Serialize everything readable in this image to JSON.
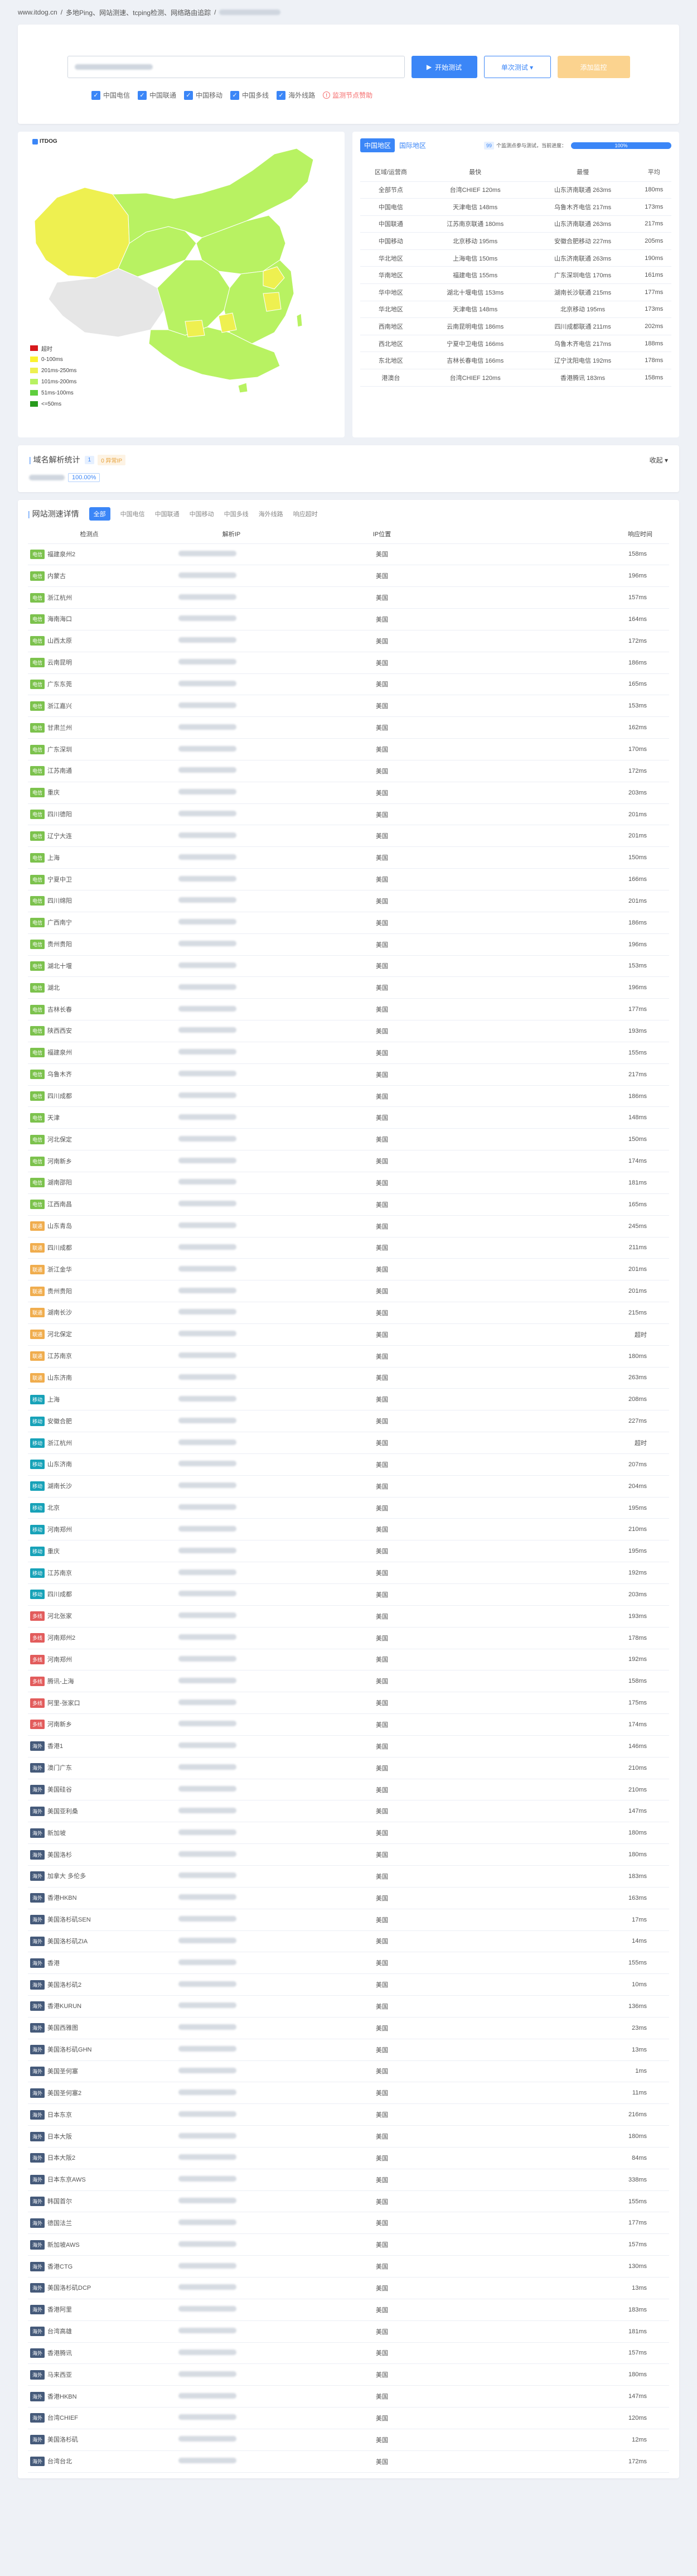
{
  "breadcrumb": [
    "www.itdog.cn",
    "/",
    "多地Ping、网站测速、tcping检测、网络路由追踪",
    "/"
  ],
  "test": {
    "start_label": "开始测试",
    "single_label": "单次测试 ▾",
    "subscribe_label": "添加监控",
    "checks": [
      "中国电信",
      "中国联通",
      "中国移动",
      "中国多线",
      "海外线路"
    ],
    "alert": "监测节点赞助"
  },
  "map": {
    "brand": "ITDOG",
    "legend": [
      {
        "label": "超时",
        "color": "#d7191c"
      },
      {
        "label": "0-100ms",
        "color": "#fcf230"
      },
      {
        "label": "201ms-250ms",
        "color": "#eef050"
      },
      {
        "label": "101ms-200ms",
        "color": "#b8f262"
      },
      {
        "label": "51ms-100ms",
        "color": "#5fce3e"
      },
      {
        "label": "<=50ms",
        "color": "#279a1c"
      }
    ]
  },
  "stats": {
    "tab_cn": "中国地区",
    "tab_intl": "国际地区",
    "nodes": "99",
    "nodes_text": "个监测点参与测试，当前进度：",
    "progress_label": "100%",
    "progress": 1.0,
    "headers": [
      "区域/运营商",
      "最快",
      "最慢",
      "平均"
    ],
    "rows": [
      [
        "全部节点",
        "台湾CHIEF 120ms",
        "山东济南联通 263ms",
        "180ms"
      ],
      [
        "中国电信",
        "天津电信 148ms",
        "乌鲁木齐电信 217ms",
        "173ms"
      ],
      [
        "中国联通",
        "江苏南京联通 180ms",
        "山东济南联通 263ms",
        "217ms"
      ],
      [
        "中国移动",
        "北京移动 195ms",
        "安徽合肥移动 227ms",
        "205ms"
      ],
      [
        "华北地区",
        "上海电信 150ms",
        "山东济南联通 263ms",
        "190ms"
      ],
      [
        "华南地区",
        "福建电信 155ms",
        "广东深圳电信 170ms",
        "161ms"
      ],
      [
        "华中地区",
        "湖北十堰电信 153ms",
        "湖南长沙联通 215ms",
        "177ms"
      ],
      [
        "华北地区",
        "天津电信 148ms",
        "北京移动 195ms",
        "173ms"
      ],
      [
        "西南地区",
        "云南昆明电信 186ms",
        "四川成都联通 211ms",
        "202ms"
      ],
      [
        "西北地区",
        "宁夏中卫电信 166ms",
        "乌鲁木齐电信 217ms",
        "188ms"
      ],
      [
        "东北地区",
        "吉林长春电信 166ms",
        "辽宁沈阳电信 192ms",
        "178ms"
      ],
      [
        "港澳台",
        "台湾CHIEF 120ms",
        "香港腾讯 183ms",
        "158ms"
      ]
    ]
  },
  "dns": {
    "title": "域名解析统计",
    "count": "1",
    "pending": "0 异常IP",
    "fold": "收起 ▾",
    "pct": "100.00%"
  },
  "detail": {
    "title": "网站测速详情",
    "tabs": [
      "全部",
      "中国电信",
      "中国联通",
      "中国移动",
      "中国多线",
      "海外线路",
      "响应超时"
    ],
    "headers": [
      "检测点",
      "解析IP",
      "IP位置",
      "响应时间"
    ],
    "isp_colors": {
      "电信": "#7cc24d",
      "联通": "#f0ad4e",
      "移动": "#17a2b8",
      "多线": "#e25c5c",
      "海外": "#455a7a"
    },
    "rows": [
      [
        "电信",
        "福建泉州2",
        "美国",
        "158ms"
      ],
      [
        "电信",
        "内蒙古",
        "美国",
        "196ms"
      ],
      [
        "电信",
        "浙江杭州",
        "美国",
        "157ms"
      ],
      [
        "电信",
        "海南海口",
        "美国",
        "164ms"
      ],
      [
        "电信",
        "山西太原",
        "美国",
        "172ms"
      ],
      [
        "电信",
        "云南昆明",
        "美国",
        "186ms"
      ],
      [
        "电信",
        "广东东莞",
        "美国",
        "165ms"
      ],
      [
        "电信",
        "浙江嘉兴",
        "美国",
        "153ms"
      ],
      [
        "电信",
        "甘肃兰州",
        "美国",
        "162ms"
      ],
      [
        "电信",
        "广东深圳",
        "美国",
        "170ms"
      ],
      [
        "电信",
        "江苏南通",
        "美国",
        "172ms"
      ],
      [
        "电信",
        "重庆",
        "美国",
        "203ms"
      ],
      [
        "电信",
        "四川德阳",
        "美国",
        "201ms"
      ],
      [
        "电信",
        "辽宁大连",
        "美国",
        "201ms"
      ],
      [
        "电信",
        "上海",
        "美国",
        "150ms"
      ],
      [
        "电信",
        "宁夏中卫",
        "美国",
        "166ms"
      ],
      [
        "电信",
        "四川绵阳",
        "美国",
        "201ms"
      ],
      [
        "电信",
        "广西南宁",
        "美国",
        "186ms"
      ],
      [
        "电信",
        "贵州贵阳",
        "美国",
        "196ms"
      ],
      [
        "电信",
        "湖北十堰",
        "美国",
        "153ms"
      ],
      [
        "电信",
        "湖北",
        "美国",
        "196ms"
      ],
      [
        "电信",
        "吉林长春",
        "美国",
        "177ms"
      ],
      [
        "电信",
        "陕西西安",
        "美国",
        "193ms"
      ],
      [
        "电信",
        "福建泉州",
        "美国",
        "155ms"
      ],
      [
        "电信",
        "乌鲁木齐",
        "美国",
        "217ms"
      ],
      [
        "电信",
        "四川成都",
        "美国",
        "186ms"
      ],
      [
        "电信",
        "天津",
        "美国",
        "148ms"
      ],
      [
        "电信",
        "河北保定",
        "美国",
        "150ms"
      ],
      [
        "电信",
        "河南新乡",
        "美国",
        "174ms"
      ],
      [
        "电信",
        "湖南邵阳",
        "美国",
        "181ms"
      ],
      [
        "电信",
        "江西南昌",
        "美国",
        "165ms"
      ],
      [
        "联通",
        "山东青岛",
        "美国",
        "245ms"
      ],
      [
        "联通",
        "四川成都",
        "美国",
        "211ms"
      ],
      [
        "联通",
        "浙江金华",
        "美国",
        "201ms"
      ],
      [
        "联通",
        "贵州贵阳",
        "美国",
        "201ms"
      ],
      [
        "联通",
        "湖南长沙",
        "美国",
        "215ms"
      ],
      [
        "联通",
        "河北保定",
        "美国",
        "超时"
      ],
      [
        "联通",
        "江苏南京",
        "美国",
        "180ms"
      ],
      [
        "联通",
        "山东济南",
        "美国",
        "263ms"
      ],
      [
        "移动",
        "上海",
        "美国",
        "208ms"
      ],
      [
        "移动",
        "安徽合肥",
        "美国",
        "227ms"
      ],
      [
        "移动",
        "浙江杭州",
        "美国",
        "超时"
      ],
      [
        "移动",
        "山东济南",
        "美国",
        "207ms"
      ],
      [
        "移动",
        "湖南长沙",
        "美国",
        "204ms"
      ],
      [
        "移动",
        "北京",
        "美国",
        "195ms"
      ],
      [
        "移动",
        "河南郑州",
        "美国",
        "210ms"
      ],
      [
        "移动",
        "重庆",
        "美国",
        "195ms"
      ],
      [
        "移动",
        "江苏南京",
        "美国",
        "192ms"
      ],
      [
        "移动",
        "四川成都",
        "美国",
        "203ms"
      ],
      [
        "多线",
        "河北张家",
        "美国",
        "193ms"
      ],
      [
        "多线",
        "河南郑州2",
        "美国",
        "178ms"
      ],
      [
        "多线",
        "河南郑州",
        "美国",
        "192ms"
      ],
      [
        "多线",
        "腾讯-上海",
        "美国",
        "158ms"
      ],
      [
        "多线",
        "阿里-张家口",
        "美国",
        "175ms"
      ],
      [
        "多线",
        "河南新乡",
        "美国",
        "174ms"
      ],
      [
        "海外",
        "香港1",
        "美国",
        "146ms"
      ],
      [
        "海外",
        "澳门广东",
        "美国",
        "210ms"
      ],
      [
        "海外",
        "美国硅谷",
        "美国",
        "210ms"
      ],
      [
        "海外",
        "美国亚利桑",
        "美国",
        "147ms"
      ],
      [
        "海外",
        "新加坡",
        "美国",
        "180ms"
      ],
      [
        "海外",
        "美国洛杉",
        "美国",
        "180ms"
      ],
      [
        "海外",
        "加拿大 多伦多",
        "美国",
        "183ms"
      ],
      [
        "海外",
        "香港HKBN",
        "美国",
        "163ms"
      ],
      [
        "海外",
        "美国洛杉矶SEN",
        "美国",
        "17ms"
      ],
      [
        "海外",
        "美国洛杉矶ZIA",
        "美国",
        "14ms"
      ],
      [
        "海外",
        "香港",
        "美国",
        "155ms"
      ],
      [
        "海外",
        "美国洛杉矶2",
        "美国",
        "10ms"
      ],
      [
        "海外",
        "香港KURUN",
        "美国",
        "136ms"
      ],
      [
        "海外",
        "美国西雅图",
        "美国",
        "23ms"
      ],
      [
        "海外",
        "美国洛杉矶GHN",
        "美国",
        "13ms"
      ],
      [
        "海外",
        "美国圣何塞",
        "美国",
        "1ms"
      ],
      [
        "海外",
        "美国圣何塞2",
        "美国",
        "11ms"
      ],
      [
        "海外",
        "日本东京",
        "美国",
        "216ms"
      ],
      [
        "海外",
        "日本大阪",
        "美国",
        "180ms"
      ],
      [
        "海外",
        "日本大阪2",
        "美国",
        "84ms"
      ],
      [
        "海外",
        "日本东京AWS",
        "美国",
        "338ms"
      ],
      [
        "海外",
        "韩国首尔",
        "美国",
        "155ms"
      ],
      [
        "海外",
        "德国法兰",
        "美国",
        "177ms"
      ],
      [
        "海外",
        "新加坡AWS",
        "美国",
        "157ms"
      ],
      [
        "海外",
        "香港CTG",
        "美国",
        "130ms"
      ],
      [
        "海外",
        "美国洛杉矶DCP",
        "美国",
        "13ms"
      ],
      [
        "海外",
        "香港阿里",
        "美国",
        "183ms"
      ],
      [
        "海外",
        "台湾高雄",
        "美国",
        "181ms"
      ],
      [
        "海外",
        "香港腾讯",
        "美国",
        "157ms"
      ],
      [
        "海外",
        "马来西亚",
        "美国",
        "180ms"
      ],
      [
        "海外",
        "香港HKBN",
        "美国",
        "147ms"
      ],
      [
        "海外",
        "台湾CHIEF",
        "美国",
        "120ms"
      ],
      [
        "海外",
        "美国洛杉矶",
        "美国",
        "12ms"
      ],
      [
        "海外",
        "台湾台北",
        "美国",
        "172ms"
      ]
    ]
  }
}
